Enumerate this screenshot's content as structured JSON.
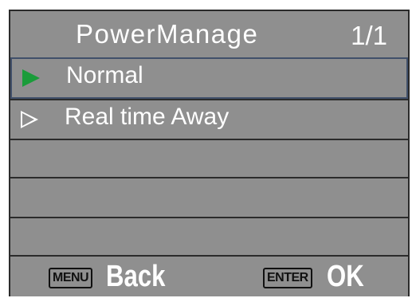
{
  "header": {
    "title": "PowerManage",
    "page": "1/1"
  },
  "menu": {
    "items": [
      {
        "label": "Normal",
        "selected": true
      },
      {
        "label": "Real time Away",
        "selected": false
      },
      {
        "label": ""
      },
      {
        "label": ""
      },
      {
        "label": ""
      }
    ]
  },
  "footer": {
    "menu_key": "MENU",
    "back_label": "Back",
    "enter_key": "ENTER",
    "ok_label": "OK"
  },
  "colors": {
    "background": "#8f8f8f",
    "selected_arrow": "#1a9c3a",
    "text": "#ffffff"
  }
}
